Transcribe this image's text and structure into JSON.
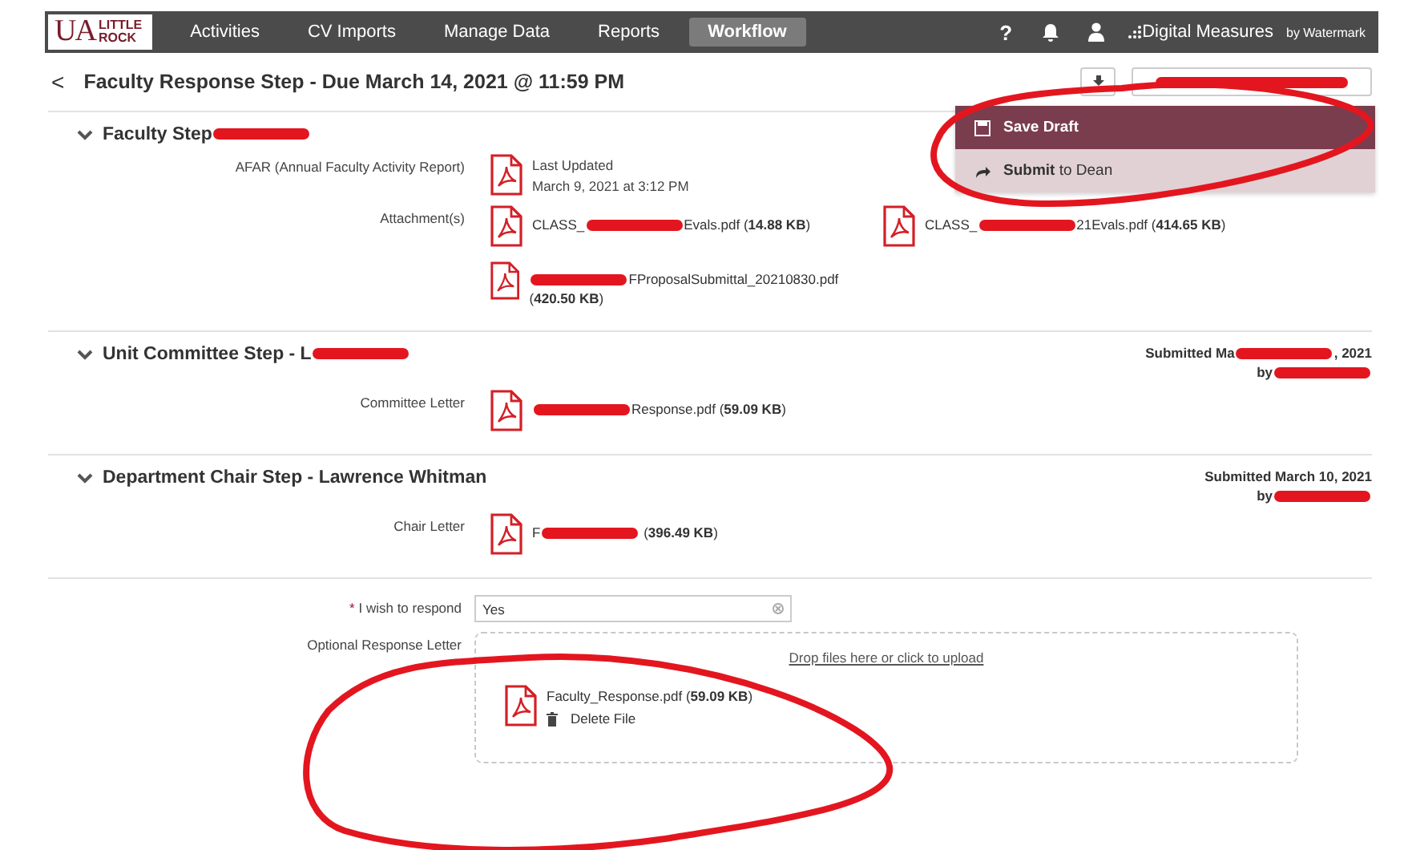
{
  "nav": {
    "logo": {
      "big": "UA",
      "top": "LITTLE",
      "bottom": "ROCK"
    },
    "tabs": [
      {
        "label": "Activities",
        "selected": false
      },
      {
        "label": "CV Imports",
        "selected": false
      },
      {
        "label": "Manage Data",
        "selected": false
      },
      {
        "label": "Reports",
        "selected": false
      },
      {
        "label": "Workflow",
        "selected": true
      }
    ],
    "help": "?",
    "brand": {
      "name": "Digital Measures",
      "by": "by Watermark"
    }
  },
  "header": {
    "back": "<",
    "title": "Faculty Response Step - Due March 14, 2021 @ 11:59 PM"
  },
  "menu": [
    {
      "kind": "save",
      "label": "Save Draft",
      "selected": true
    },
    {
      "kind": "submit",
      "label": "**Submit** to Dean",
      "selected": false
    }
  ],
  "sections": [
    {
      "title": [
        {
          "text": "Faculty Step"
        },
        {
          "kind": "scribble"
        }
      ],
      "rows": [
        {
          "label": [
            {
              "text": "AFAR (Annual Faculty Activity Report)"
            }
          ],
          "kind": "updated",
          "lines": [
            "Last Updated",
            "March 9, 2021 at 3:12 PM"
          ]
        },
        {
          "label": [
            {
              "text": "Attachment(s)"
            }
          ],
          "kind": "files",
          "files": [
            {
              "name": [
                {
                  "text": "CLASS_"
                },
                {
                  "kind": "scribble"
                },
                {
                  "text": "Evals.pdf"
                }
              ],
              "size": "(**14.88 KB**)"
            },
            {
              "name": [
                {
                  "text": "CLASS_"
                },
                {
                  "kind": "scribble"
                },
                {
                  "text": "21Evals.pdf"
                }
              ],
              "size": "(**414.65 KB**)"
            },
            {
              "name": [
                {
                  "kind": "scribble"
                },
                {
                  "text": "FProposalSubmittal_20210830.pdf"
                }
              ],
              "size": "(**420.50 KB**)"
            }
          ]
        }
      ]
    },
    {
      "title": [
        {
          "text": "Unit Committee Step - L"
        },
        {
          "kind": "scribble"
        }
      ],
      "submitted": [
        [
          {
            "text": "Submitted Ma"
          },
          {
            "kind": "scribble"
          },
          {
            "text": ", 2021"
          }
        ],
        [
          {
            "text": "by"
          },
          {
            "kind": "scribble"
          }
        ]
      ],
      "rows": [
        {
          "label": [
            {
              "text": "Committee Letter"
            }
          ],
          "kind": "files",
          "files": [
            {
              "name": [
                {
                  "kind": "scribble"
                },
                {
                  "text": "Response.pdf"
                }
              ],
              "size": "(**59.09 KB**)"
            }
          ]
        }
      ]
    },
    {
      "title": [
        {
          "text": "Department Chair Step - Lawrence Whitman"
        }
      ],
      "submitted": [
        [
          {
            "text": "Submitted March 10, 2021"
          }
        ],
        [
          {
            "text": "by"
          },
          {
            "kind": "scribble"
          }
        ]
      ],
      "rows": [
        {
          "label": [
            {
              "text": "Chair Letter"
            }
          ],
          "kind": "files",
          "files": [
            {
              "name": [
                {
                  "text": "F"
                },
                {
                  "kind": "scribble"
                }
              ],
              "size": "(**396.49 KB**)"
            }
          ]
        }
      ]
    }
  ],
  "form": {
    "respond": {
      "required": "*",
      "label": "I wish to respond",
      "value": "Yes"
    },
    "letter": {
      "label": "Optional Response Letter",
      "drop": "Drop files here or click to upload",
      "file": "Faculty_Response.pdf (**59.09 KB**)",
      "delete": "Delete File"
    }
  }
}
